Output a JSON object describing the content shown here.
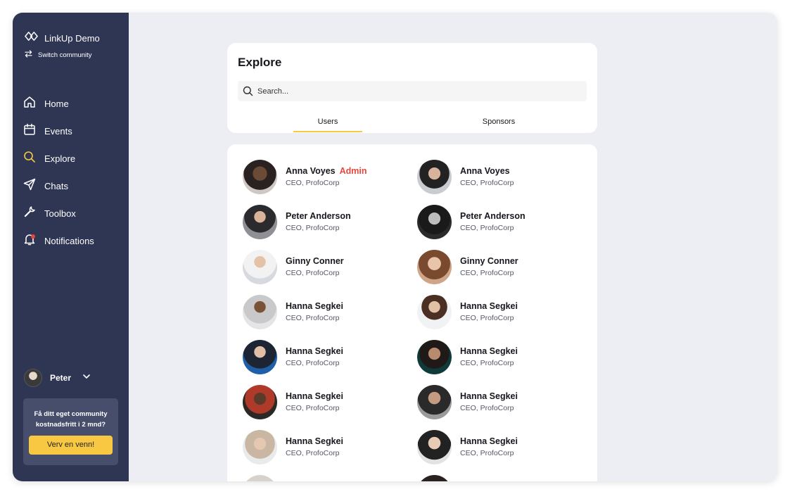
{
  "sidebar": {
    "brand_name": "LinkUp Demo",
    "switch_label": "Switch community",
    "items": [
      {
        "label": "Home",
        "icon": "home-icon"
      },
      {
        "label": "Events",
        "icon": "calendar-icon"
      },
      {
        "label": "Explore",
        "icon": "search-icon",
        "active": true
      },
      {
        "label": "Chats",
        "icon": "send-icon"
      },
      {
        "label": "Toolbox",
        "icon": "wrench-icon"
      },
      {
        "label": "Notifications",
        "icon": "bell-icon"
      }
    ],
    "user_name": "Peter",
    "promo_text": "Få ditt eget community kostnadsfritt i 2 mnd?",
    "promo_button": "Verv en venn!"
  },
  "explore": {
    "title": "Explore",
    "search_placeholder": "Search...",
    "tabs": [
      {
        "label": "Users",
        "active": true
      },
      {
        "label": "Sponsors",
        "active": false
      }
    ]
  },
  "people": [
    {
      "name": "Anna Voyes",
      "badge": "Admin",
      "role": "CEO, ProfoCorp"
    },
    {
      "name": "Anna Voyes",
      "badge": "",
      "role": "CEO, ProfoCorp"
    },
    {
      "name": "Peter Anderson",
      "badge": "",
      "role": "CEO, ProfoCorp"
    },
    {
      "name": "Peter Anderson",
      "badge": "",
      "role": "CEO, ProfoCorp"
    },
    {
      "name": "Ginny Conner",
      "badge": "",
      "role": "CEO, ProfoCorp"
    },
    {
      "name": "Ginny Conner",
      "badge": "",
      "role": "CEO, ProfoCorp"
    },
    {
      "name": "Hanna Segkei",
      "badge": "",
      "role": "CEO, ProfoCorp"
    },
    {
      "name": "Hanna Segkei",
      "badge": "",
      "role": "CEO, ProfoCorp"
    },
    {
      "name": "Hanna Segkei",
      "badge": "",
      "role": "CEO, ProfoCorp"
    },
    {
      "name": "Hanna Segkei",
      "badge": "",
      "role": "CEO, ProfoCorp"
    },
    {
      "name": "Hanna Segkei",
      "badge": "",
      "role": "CEO, ProfoCorp"
    },
    {
      "name": "Hanna Segkei",
      "badge": "",
      "role": "CEO, ProfoCorp"
    },
    {
      "name": "Hanna Segkei",
      "badge": "",
      "role": "CEO, ProfoCorp"
    },
    {
      "name": "Hanna Segkei",
      "badge": "",
      "role": "CEO, ProfoCorp"
    }
  ],
  "colors": {
    "sidebar_bg": "#2f3654",
    "accent": "#f8c843",
    "admin_red": "#e8453c",
    "app_bg": "#eceef4"
  }
}
